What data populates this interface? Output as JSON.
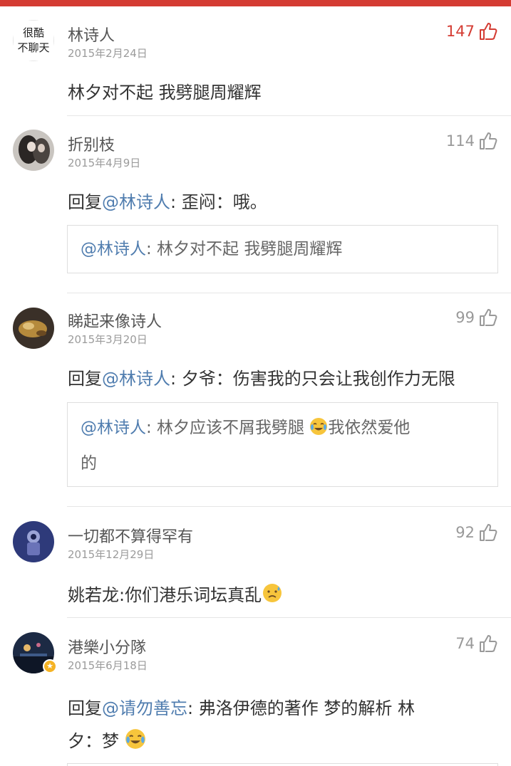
{
  "comments": [
    {
      "avatar_text_line1": "很酷",
      "avatar_text_line2": "不聊天",
      "username": "林诗人",
      "date": "2015年2月24日",
      "likes": "147",
      "text": "林夕对不起  我劈腿周耀辉"
    },
    {
      "username": "折别枝",
      "date": "2015年4月9日",
      "likes": "114",
      "reply_prefix": "回复",
      "reply_mention": "@林诗人",
      "reply_text": ": 歪闷：哦。",
      "quote_mention": "@林诗人",
      "quote_text": ": 林夕对不起  我劈腿周耀辉"
    },
    {
      "username": "睇起来像诗人",
      "date": "2015年3月20日",
      "likes": "99",
      "reply_prefix": "回复",
      "reply_mention": "@林诗人",
      "reply_text": ": 夕爷：伤害我的只会让我创作力无限",
      "quote_mention": "@林诗人",
      "quote_text_a": ": 林夕应该不屑我劈腿 ",
      "quote_text_b": "我依然爱他",
      "quote_text_c": "的"
    },
    {
      "username": "一切都不算得罕有",
      "date": "2015年12月29日",
      "likes": "92",
      "text": "姚若龙:你们港乐词坛真乱"
    },
    {
      "username": "港樂小分隊",
      "date": "2015年6月18日",
      "likes": "74",
      "reply_prefix": "回复",
      "reply_mention": "@请勿善忘",
      "reply_text": ": 弗洛伊德的著作   梦的解析     林",
      "reply_text_line2": "夕：梦 "
    }
  ],
  "colors": {
    "accent": "#d43c33",
    "mention": "#507daf",
    "like_inactive": "#999999"
  },
  "icons": {
    "like": "thumbs-up-icon",
    "tears_of_joy": "tears-of-joy-emoji",
    "sad": "sad-sweat-emoji",
    "vip": "star-badge-icon"
  }
}
